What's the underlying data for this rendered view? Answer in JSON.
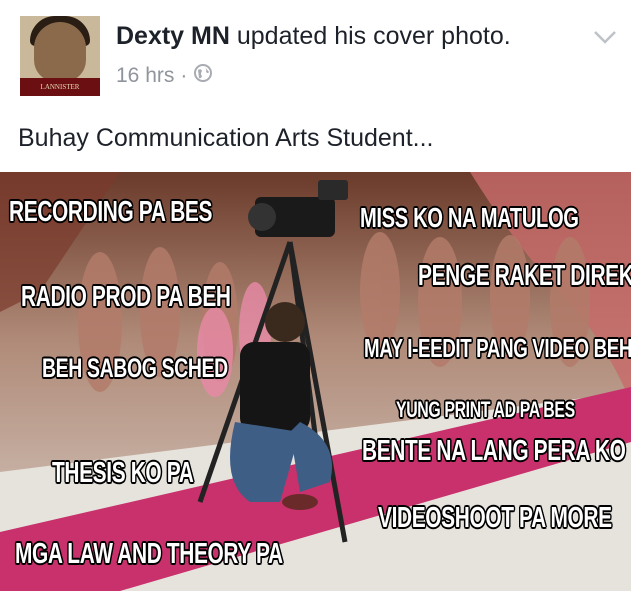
{
  "post": {
    "author_name": "Dexty MN",
    "action": "updated his cover photo.",
    "time": "16 hrs",
    "separator": "·",
    "avatar_badge": "LANNISTER",
    "caption": "Buhay Communication Arts Student..."
  },
  "icons": {
    "privacy": "globe-icon",
    "menu": "chevron-down-icon"
  },
  "colors": {
    "text": "#1d2129",
    "meta": "#90949c",
    "carpet": "#c8316b"
  },
  "photo": {
    "overlay_texts": [
      "RECORDING PA BES",
      "RADIO PROD PA BEH",
      "BEH SABOG SCHED",
      "THESIS KO PA",
      "MGA LAW AND THEORY PA",
      "MISS KO NA MATULOG",
      "PENGE RAKET DIREK",
      "MAY I-EEDIT PANG VIDEO BEH",
      "YUNG PRINT AD PA BES",
      "BENTE NA LANG PERA KO",
      "VIDEOSHOOT PA MORE"
    ]
  }
}
